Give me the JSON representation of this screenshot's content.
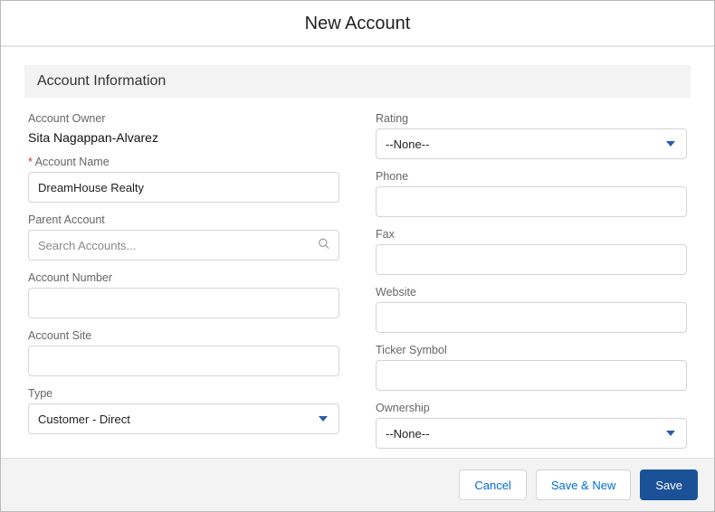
{
  "header": {
    "title": "New Account"
  },
  "section": {
    "title": "Account Information"
  },
  "left": {
    "owner_label": "Account Owner",
    "owner_value": "Sita Nagappan-Alvarez",
    "account_name_label": "Account Name",
    "account_name_value": "DreamHouse Realty",
    "parent_label": "Parent Account",
    "parent_placeholder": "Search Accounts...",
    "number_label": "Account Number",
    "number_value": "",
    "site_label": "Account Site",
    "site_value": "",
    "type_label": "Type",
    "type_value": "Customer - Direct"
  },
  "right": {
    "rating_label": "Rating",
    "rating_value": "--None--",
    "phone_label": "Phone",
    "phone_value": "",
    "fax_label": "Fax",
    "fax_value": "",
    "website_label": "Website",
    "website_value": "",
    "ticker_label": "Ticker Symbol",
    "ticker_value": "",
    "ownership_label": "Ownership",
    "ownership_value": "--None--"
  },
  "footer": {
    "cancel": "Cancel",
    "save_new": "Save & New",
    "save": "Save"
  }
}
